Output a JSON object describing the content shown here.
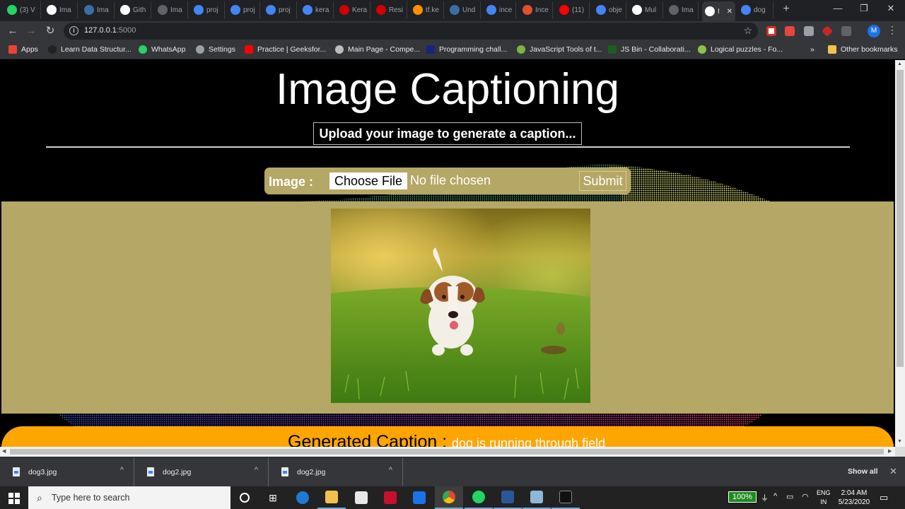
{
  "browser": {
    "tabs": [
      {
        "label": "(3) V",
        "icon": "whatsapp-icon",
        "color": "#25d366"
      },
      {
        "label": "Ima",
        "icon": "github-icon",
        "color": "#ffffff"
      },
      {
        "label": "Ima",
        "icon": "site-icon",
        "color": "#3c6ea5"
      },
      {
        "label": "Gith",
        "icon": "github-icon",
        "color": "#ffffff"
      },
      {
        "label": "Ima",
        "icon": "globe-icon",
        "color": "#5f6368"
      },
      {
        "label": "proj",
        "icon": "google-icon",
        "color": "#4285f4"
      },
      {
        "label": "proj",
        "icon": "docs-icon",
        "color": "#4285f4"
      },
      {
        "label": "proj",
        "icon": "docs-icon",
        "color": "#4285f4"
      },
      {
        "label": "kera",
        "icon": "google-icon",
        "color": "#4285f4"
      },
      {
        "label": "Kera",
        "icon": "keras-icon",
        "color": "#d00000"
      },
      {
        "label": "Resi",
        "icon": "keras-icon",
        "color": "#d00000"
      },
      {
        "label": "tf.ke",
        "icon": "tensorflow-icon",
        "color": "#ff8f00"
      },
      {
        "label": "Und",
        "icon": "site-icon",
        "color": "#3c6ea5"
      },
      {
        "label": "ince",
        "icon": "google-icon",
        "color": "#4285f4"
      },
      {
        "label": "Ince",
        "icon": "arxiv-icon",
        "color": "#e05030"
      },
      {
        "label": "(11)",
        "icon": "youtube-icon",
        "color": "#ff0000"
      },
      {
        "label": "obje",
        "icon": "google-icon",
        "color": "#4285f4"
      },
      {
        "label": "Mul",
        "icon": "medium-icon",
        "color": "#ffffff"
      },
      {
        "label": "Ima",
        "icon": "globe-icon",
        "color": "#5f6368"
      },
      {
        "label": "I",
        "icon": "globe-icon",
        "color": "#ffffff",
        "active": true
      },
      {
        "label": "dog",
        "icon": "google-icon",
        "color": "#4285f4"
      }
    ],
    "new_tab": "+",
    "window_controls": {
      "minimize": "—",
      "maximize": "❐",
      "close": "✕"
    },
    "url": {
      "host": "127.0.0.1",
      "port": ":5000"
    },
    "profile_initial": "M",
    "bookmarks": [
      {
        "label": "Apps",
        "color": "#ea4335"
      },
      {
        "label": "Learn Data Structur...",
        "color": "#222222"
      },
      {
        "label": "WhatsApp",
        "color": "#25d366"
      },
      {
        "label": "Settings",
        "color": "#9aa0a6"
      },
      {
        "label": "Practice | Geeksfor...",
        "color": "#ff0000"
      },
      {
        "label": "Main Page - Compe...",
        "color": "#bdbdbd"
      },
      {
        "label": "Programming chall...",
        "color": "#1a237e"
      },
      {
        "label": "JavaScript Tools of t...",
        "color": "#7cb342"
      },
      {
        "label": "JS Bin - Collaborati...",
        "color": "#1b5e20"
      },
      {
        "label": "Logical puzzles - Fo...",
        "color": "#8bc34a"
      }
    ],
    "bookmarks_overflow": "»",
    "other_bookmarks": "Other bookmarks"
  },
  "page": {
    "title": "Image Captioning",
    "subtitle": "Upload your image to generate a caption...",
    "form": {
      "label": "Image :",
      "choose_file": "Choose File",
      "no_file": "No file chosen",
      "submit": "Submit"
    },
    "caption_label": "Generated Caption :",
    "caption_text": "dog is running through field",
    "colors": {
      "panel": "#b5a765",
      "caption_bar": "#ffa500"
    }
  },
  "downloads": {
    "items": [
      {
        "name": "dog3.jpg"
      },
      {
        "name": "dog2.jpg"
      },
      {
        "name": "dog2.jpg"
      }
    ],
    "show_all": "Show all"
  },
  "taskbar": {
    "search_placeholder": "Type here to search",
    "battery": "100%",
    "language": [
      "ENG",
      "IN"
    ],
    "time": "2:04 AM",
    "date": "5/23/2020"
  }
}
